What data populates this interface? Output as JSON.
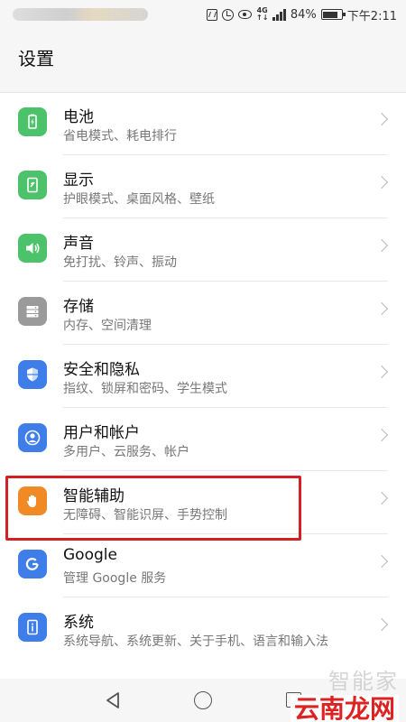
{
  "status_bar": {
    "network_type": "4G",
    "battery": "84%",
    "time": "下午2:11"
  },
  "header": {
    "title": "设置"
  },
  "settings": [
    {
      "label": "电池",
      "sub": "省电模式、耗电排行",
      "icon": "battery-icon",
      "color": "#4cc36b"
    },
    {
      "label": "显示",
      "sub": "护眼模式、桌面风格、壁纸",
      "icon": "display-icon",
      "color": "#4cc36b"
    },
    {
      "label": "声音",
      "sub": "免打扰、铃声、振动",
      "icon": "speaker-icon",
      "color": "#4cc36b"
    },
    {
      "label": "存储",
      "sub": "内存、空间清理",
      "icon": "storage-icon",
      "color": "#9a9a9a"
    },
    {
      "label": "安全和隐私",
      "sub": "指纹、锁屏和密码、学生模式",
      "icon": "shield-icon",
      "color": "#3f7ee8"
    },
    {
      "label": "用户和帐户",
      "sub": "多用户、云服务、帐户",
      "icon": "user-icon",
      "color": "#3f7ee8"
    },
    {
      "label": "智能辅助",
      "sub": "无障碍、智能识屏、手势控制",
      "icon": "hand-icon",
      "color": "#f08a24"
    },
    {
      "label": "Google",
      "sub": "管理 Google 服务",
      "icon": "google-icon",
      "color": "#3f7ee8"
    },
    {
      "label": "系统",
      "sub": "系统导航、系统更新、关于手机、语言和输入法",
      "icon": "info-icon",
      "color": "#3f7ee8"
    }
  ],
  "highlight_color": "#d32025",
  "watermark": {
    "faint": "智能家",
    "main": "云南龙网"
  }
}
